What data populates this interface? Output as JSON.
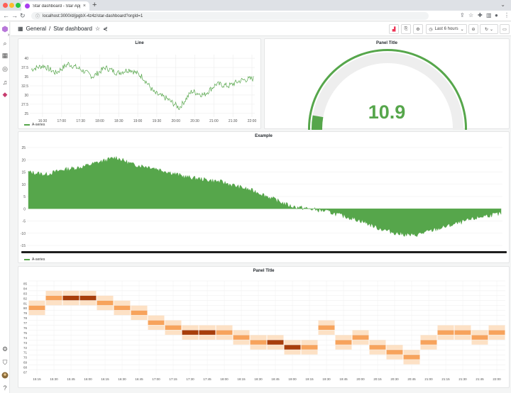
{
  "browser": {
    "tab_title": "Star dashboard - Star Applicati...",
    "url": "localhost:3000/d/jpgbX-4z4z/star-dashboard?orgId=1"
  },
  "topbar": {
    "breadcrumb_root": "General",
    "breadcrumb_sep": "/",
    "dashboard_title": "Star dashboard",
    "time_range": "Last 6 hours"
  },
  "colors": {
    "series": "#56a64b",
    "heatmap_light": "#fde1c5",
    "heatmap_mid": "#f7a35c",
    "heatmap_dark": "#a83e0b"
  },
  "panels": {
    "line": {
      "title": "Line",
      "legend": "A-series",
      "y_ticks": [
        "40",
        "37.5",
        "35",
        "32.5",
        "30",
        "27.5",
        "25"
      ],
      "x_ticks": [
        "16:30",
        "17:00",
        "17:30",
        "18:00",
        "18:30",
        "19:00",
        "19:30",
        "20:00",
        "20:30",
        "21:00",
        "21:30",
        "22:00"
      ]
    },
    "gauge": {
      "title": "Panel Title",
      "value": "10.9",
      "fraction": 0.11
    },
    "example": {
      "title": "Example",
      "legend": "A-series",
      "y_ticks": [
        "25",
        "20",
        "15",
        "10",
        "5",
        "0",
        "-5",
        "-10",
        "-15"
      ]
    },
    "heatmap": {
      "title": "Panel Title",
      "y_ticks": [
        "85",
        "84",
        "83",
        "82",
        "81",
        "80",
        "79",
        "78",
        "77",
        "76",
        "75",
        "74",
        "73",
        "72",
        "71",
        "70",
        "69",
        "68",
        "67"
      ],
      "x_ticks": [
        "15:15",
        "15:30",
        "15:45",
        "16:00",
        "16:15",
        "16:30",
        "16:45",
        "17:00",
        "17:15",
        "17:30",
        "17:45",
        "18:00",
        "18:15",
        "18:30",
        "18:45",
        "19:00",
        "19:15",
        "19:30",
        "19:45",
        "20:00",
        "20:15",
        "20:30",
        "20:45",
        "21:00",
        "21:15",
        "21:30",
        "21:45",
        "22:00"
      ]
    }
  },
  "chart_data": [
    {
      "type": "line",
      "title": "Line",
      "series": [
        {
          "name": "A-series",
          "x": [
            "16:10",
            "16:30",
            "16:50",
            "17:10",
            "17:30",
            "17:50",
            "18:10",
            "18:30",
            "18:50",
            "19:10",
            "19:30",
            "19:50",
            "20:10",
            "20:30",
            "20:50",
            "21:10",
            "21:30",
            "21:50",
            "22:10"
          ],
          "values": [
            37,
            38,
            36,
            38.5,
            37,
            35,
            37.5,
            36,
            37,
            35,
            30.5,
            29,
            26.5,
            31,
            30,
            33,
            32.5,
            34,
            34.5
          ]
        }
      ],
      "ylim": [
        24,
        41
      ]
    },
    {
      "type": "area",
      "title": "Example",
      "series": [
        {
          "name": "A-series",
          "values": [
            15,
            14,
            16,
            17,
            19,
            21,
            18,
            17,
            15,
            13,
            12,
            11,
            9,
            7,
            4,
            1,
            0,
            -1,
            -3,
            -5,
            -8,
            -10,
            -11,
            -9,
            -7,
            -5,
            -3,
            -2
          ]
        }
      ],
      "ylim": [
        -15,
        25
      ]
    },
    {
      "type": "heatmap",
      "title": "Panel Title",
      "x": [
        "15:15",
        "15:30",
        "15:45",
        "16:00",
        "16:15",
        "16:30",
        "16:45",
        "17:00",
        "17:15",
        "17:30",
        "17:45",
        "18:00",
        "18:15",
        "18:30",
        "18:45",
        "19:00",
        "19:15",
        "19:30",
        "19:45",
        "20:00",
        "20:15",
        "20:30",
        "20:45",
        "21:00",
        "21:15",
        "21:30",
        "21:45",
        "22:00"
      ],
      "y_min": 67,
      "y_max": 85,
      "peaks": [
        80,
        82,
        82,
        82,
        81,
        80,
        79,
        77,
        76,
        75,
        75,
        75,
        74,
        73,
        73,
        72,
        72,
        76,
        73,
        74,
        72,
        71,
        70,
        73,
        75,
        75,
        74,
        75
      ],
      "intensity": [
        2,
        2,
        3,
        3,
        2,
        2,
        2,
        2,
        2,
        3,
        3,
        2,
        2,
        2,
        3,
        3,
        2,
        2,
        2,
        2,
        2,
        2,
        2,
        2,
        2,
        2,
        2,
        2
      ]
    }
  ]
}
